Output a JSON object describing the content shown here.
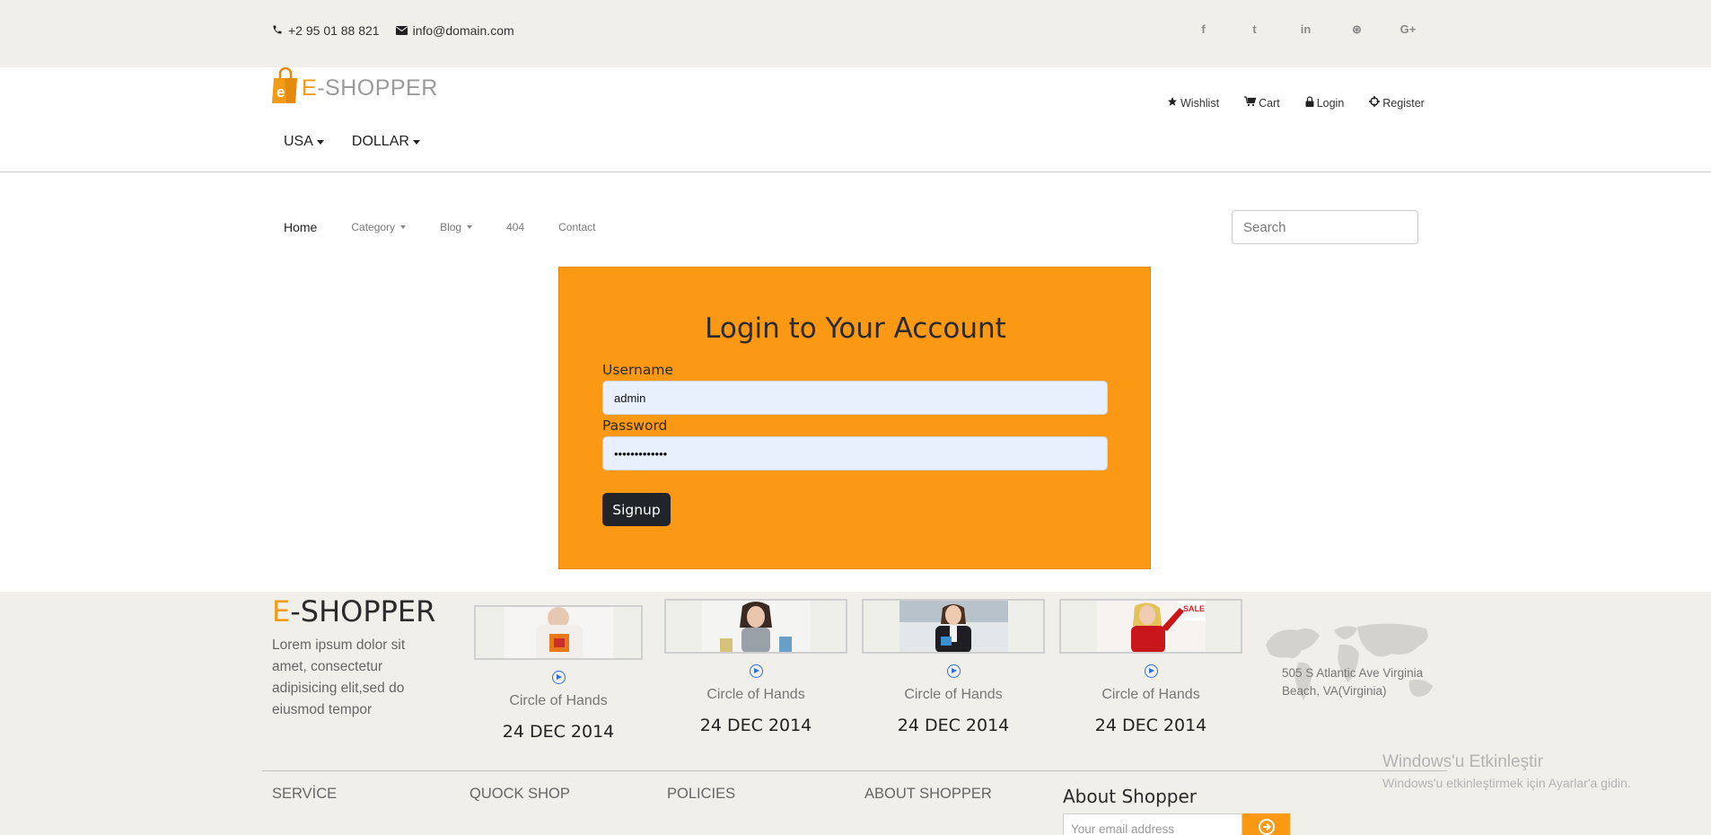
{
  "topbar": {
    "phone": "+2 95 01 88 821",
    "email": "info@domain.com",
    "social": [
      "facebook-icon",
      "twitter-icon",
      "linkedin-icon",
      "dribbble-icon",
      "google-plus-icon"
    ],
    "social_glyphs": [
      "f",
      "t",
      "in",
      "⊛",
      "G+"
    ]
  },
  "header": {
    "logo_letter": "E",
    "logo_rest": "-SHOPPER",
    "country": "USA",
    "currency": "DOLLAR",
    "account": {
      "wishlist": "Wishlist",
      "cart": "Cart",
      "login": "Login",
      "register": "Register"
    }
  },
  "nav": {
    "home": "Home",
    "category": "Category",
    "blog": "Blog",
    "notfound": "404",
    "contact": "Contact",
    "search_placeholder": "Search"
  },
  "login": {
    "title": "Login to Your Account",
    "username_label": "Username",
    "username_value": "admin",
    "password_label": "Password",
    "password_value": "•••••••••••••",
    "submit": "Signup"
  },
  "footer": {
    "logo_letter": "E",
    "logo_rest": "-SHOPPER",
    "description": "Lorem ipsum dolor sit amet, consectetur adipisicing elit,sed do eiusmod tempor",
    "videos": [
      {
        "caption": "Circle of Hands",
        "date": "24 DEC 2014"
      },
      {
        "caption": "Circle of Hands",
        "date": "24 DEC 2014"
      },
      {
        "caption": "Circle of Hands",
        "date": "24 DEC 2014"
      },
      {
        "caption": "Circle of Hands",
        "date": "24 DEC 2014"
      }
    ],
    "address": "505 S Atlantic Ave Virginia Beach, VA(Virginia)",
    "columns": [
      "SERVİCE",
      "QUOCK SHOP",
      "POLICIES",
      "ABOUT SHOPPER"
    ],
    "about_title": "About Shopper",
    "email_placeholder": "Your email address"
  },
  "watermark": {
    "line1": "Windows'u Etkinleştir",
    "line2": "Windows'u etkinleştirmek için Ayarlar'a gidin."
  },
  "colors": {
    "accent": "#fb9814",
    "topbar_bg": "#f0efea",
    "button_dark": "#212529"
  }
}
